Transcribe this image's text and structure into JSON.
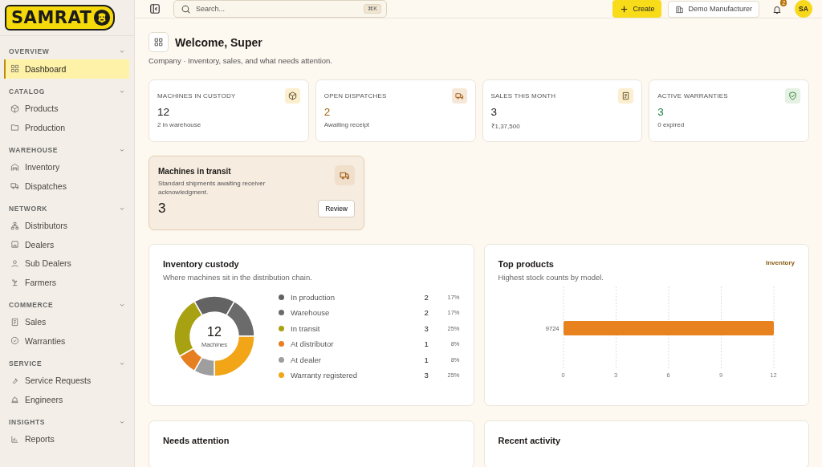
{
  "brand": "SAMRAT",
  "sidebar": {
    "sections": [
      {
        "title": "OVERVIEW",
        "expanded": true,
        "items": [
          {
            "label": "Dashboard",
            "selected": true
          }
        ]
      },
      {
        "title": "CATALOG",
        "expanded": true,
        "items": [
          {
            "label": "Products",
            "selected": false
          },
          {
            "label": "Production",
            "selected": false
          }
        ]
      },
      {
        "title": "WAREHOUSE",
        "expanded": true,
        "items": [
          {
            "label": "Inventory",
            "selected": false
          },
          {
            "label": "Dispatches",
            "selected": false
          }
        ]
      },
      {
        "title": "NETWORK",
        "expanded": true,
        "items": [
          {
            "label": "Distributors",
            "selected": false
          },
          {
            "label": "Dealers",
            "selected": false
          },
          {
            "label": "Sub Dealers",
            "selected": false
          },
          {
            "label": "Farmers",
            "selected": false
          }
        ]
      },
      {
        "title": "COMMERCE",
        "expanded": true,
        "items": [
          {
            "label": "Sales",
            "selected": false
          },
          {
            "label": "Warranties",
            "selected": false
          }
        ]
      },
      {
        "title": "SERVICE",
        "expanded": true,
        "items": [
          {
            "label": "Service Requests",
            "selected": false
          },
          {
            "label": "Engineers",
            "selected": false
          }
        ]
      },
      {
        "title": "INSIGHTS",
        "expanded": true,
        "items": [
          {
            "label": "Reports",
            "selected": false
          }
        ]
      }
    ]
  },
  "topbar": {
    "search": {
      "placeholder": "Search...",
      "shortcut": "⌘K"
    },
    "create": "Create",
    "organization": "Demo Manufacturer",
    "notifications": "2",
    "avatar": "SA"
  },
  "page": {
    "title": "Welcome, Super",
    "subtitle": "Company · Inventory, sales, and what needs attention."
  },
  "kpis": [
    {
      "label": "MACHINES IN CUSTODY",
      "value": "12",
      "note": "2 in warehouse",
      "color": "#1c1917"
    },
    {
      "label": "OPEN DISPATCHES",
      "value": "2",
      "note": "Awaiting receipt",
      "color": "#a16207"
    },
    {
      "label": "SALES THIS MONTH",
      "value": "3",
      "note": "₹1,37,500",
      "color": "#1c1917"
    },
    {
      "label": "ACTIVE WARRANTIES",
      "value": "3",
      "note": "0 expired",
      "color": "#15803d"
    }
  ],
  "transit": {
    "title": "Machines in transit",
    "description": "Standard shipments awaiting receiver acknowledgment.",
    "value": "3",
    "action": "Review"
  },
  "custody": {
    "title": "Inventory custody",
    "subtitle": "Where machines sit in the distribution chain.",
    "total": "12",
    "total_label": "Machines",
    "segments": [
      {
        "label": "In production",
        "count": "2",
        "percent": "17%",
        "color": "#636363"
      },
      {
        "label": "Warehouse",
        "count": "2",
        "percent": "17%",
        "color": "#6b6b6b"
      },
      {
        "label": "In transit",
        "count": "3",
        "percent": "25%",
        "color": "#a8a212"
      },
      {
        "label": "At distributor",
        "count": "1",
        "percent": "8%",
        "color": "#e67e22"
      },
      {
        "label": "At dealer",
        "count": "1",
        "percent": "8%",
        "color": "#9e9e9e"
      },
      {
        "label": "Warranty registered",
        "count": "3",
        "percent": "25%",
        "color": "#f2a516"
      }
    ]
  },
  "top_products": {
    "title": "Top products",
    "subtitle": "Highest stock counts by model.",
    "link": "Inventory",
    "chart_data": {
      "type": "bar",
      "orientation": "horizontal",
      "categories": [
        "9724"
      ],
      "series": [
        {
          "color": "#e8821f",
          "values": [
            12
          ]
        }
      ],
      "xlim": [
        0,
        12
      ],
      "xticks": [
        0,
        3,
        6,
        9,
        12
      ],
      "grid": true
    }
  },
  "bottom_cards": [
    {
      "title": "Needs attention"
    },
    {
      "title": "Recent activity"
    }
  ]
}
